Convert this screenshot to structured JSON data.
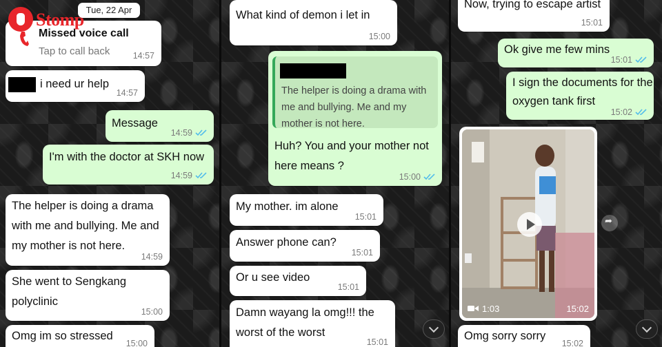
{
  "watermark": {
    "brand": "Stomp"
  },
  "panel1": {
    "date_chip": "Tue, 22 Apr",
    "missed_call": {
      "title": "Missed voice call",
      "subtitle": "Tap to call back",
      "time": "14:57"
    },
    "messages": [
      {
        "text": "i need ur help",
        "time": "14:57"
      },
      {
        "text": "Message",
        "time": "14:59"
      },
      {
        "text": "I'm with the doctor at SKH now",
        "time": "14:59"
      },
      {
        "lines": [
          "The helper is doing a drama",
          "with me and bullying. Me and",
          "my mother is not here."
        ],
        "time": "14:59"
      },
      {
        "lines": [
          "She went to Sengkang",
          "polyclinic"
        ],
        "time": "15:00"
      },
      {
        "text": "Omg im so stressed",
        "time": "15:00"
      }
    ]
  },
  "panel2": {
    "messages": [
      {
        "text": "What kind of demon i let in",
        "time": "15:00"
      },
      {
        "quote_lines": [
          "The helper is doing a drama with",
          "me and bullying. Me and my",
          "mother is not here."
        ],
        "lines": [
          "Huh? You and your mother not",
          "here means ?"
        ],
        "time": "15:00"
      },
      {
        "text": "My mother. im alone",
        "time": "15:01"
      },
      {
        "text": "Answer phone can?",
        "time": "15:01"
      },
      {
        "text": "Or u see video",
        "time": "15:01"
      },
      {
        "lines": [
          "Damn wayang la omg!!! the",
          "worst of the worst"
        ],
        "time": "15:01"
      }
    ]
  },
  "panel3": {
    "messages": [
      {
        "text": "Now, trying to escape artist",
        "time": "15:01"
      },
      {
        "text": "Ok give me few mins",
        "time": "15:01"
      },
      {
        "lines": [
          "I sign the documents for the",
          "oxygen tank first"
        ],
        "time": "15:02"
      },
      {
        "text": "Omg sorry sorry",
        "time": "15:02"
      }
    ],
    "video": {
      "duration": "1:03",
      "time": "15:02"
    }
  },
  "icons": [
    "missed-call-icon",
    "double-check-icon",
    "play-icon",
    "video-camera-icon",
    "forward-icon",
    "chevron-down-icon"
  ],
  "colors": {
    "outgoing": "#d9fdd3",
    "incoming": "#ffffff",
    "read_ticks": "#53bdeb",
    "missed_call": "#e8262b"
  }
}
